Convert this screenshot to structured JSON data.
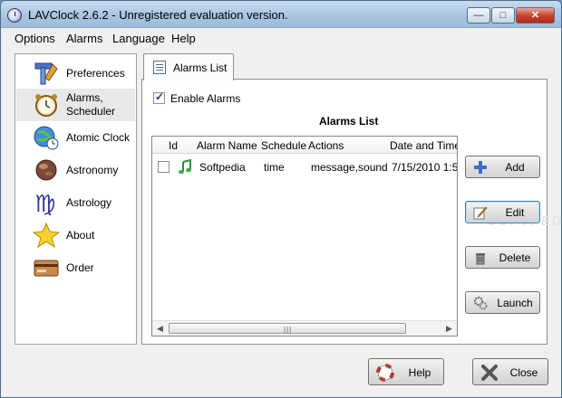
{
  "window": {
    "title": "LAVClock 2.6.2 - Unregistered evaluation version.",
    "controls": {
      "minimize": "—",
      "maximize": "□",
      "close": "✕"
    }
  },
  "menu": [
    "Options",
    "Alarms",
    "Language",
    "Help"
  ],
  "sidebar": {
    "items": [
      {
        "label": "Preferences",
        "icon": "preferences-tools-icon"
      },
      {
        "label": "Alarms,",
        "label2": "Scheduler",
        "icon": "alarm-clock-icon",
        "active": true
      },
      {
        "label": "Atomic Clock",
        "icon": "globe-clock-icon"
      },
      {
        "label": "Astronomy",
        "icon": "planet-icon"
      },
      {
        "label": "Astrology",
        "icon": "virgo-sign-icon"
      },
      {
        "label": "About",
        "icon": "star-icon"
      },
      {
        "label": "Order",
        "icon": "credit-card-icon"
      }
    ]
  },
  "tab": {
    "label": "Alarms List",
    "icon": "list-document-icon"
  },
  "panel": {
    "enable_label": "Enable Alarms",
    "enable_checked": true,
    "list_title": "Alarms List",
    "columns": [
      "Id",
      "Alarm Name",
      "Schedule",
      "Actions",
      "Date and Time"
    ],
    "rows": [
      {
        "checked": false,
        "icon": "music-note-icon",
        "name": "Softpedia",
        "schedule": "time",
        "actions": "message,sound",
        "datetime": "7/15/2010 1:5"
      }
    ],
    "scroll": {
      "left": "◀",
      "right": "▶",
      "grip": "|||"
    }
  },
  "buttons": {
    "add": "Add",
    "edit": "Edit",
    "delete": "Delete",
    "launch": "Launch",
    "help": "Help",
    "close": "Close"
  },
  "watermark": "SOFTPEDIA",
  "colors": {
    "accent": "#3c7fb1",
    "titlebar": "#a9c5e2",
    "close_red": "#c8452f"
  }
}
